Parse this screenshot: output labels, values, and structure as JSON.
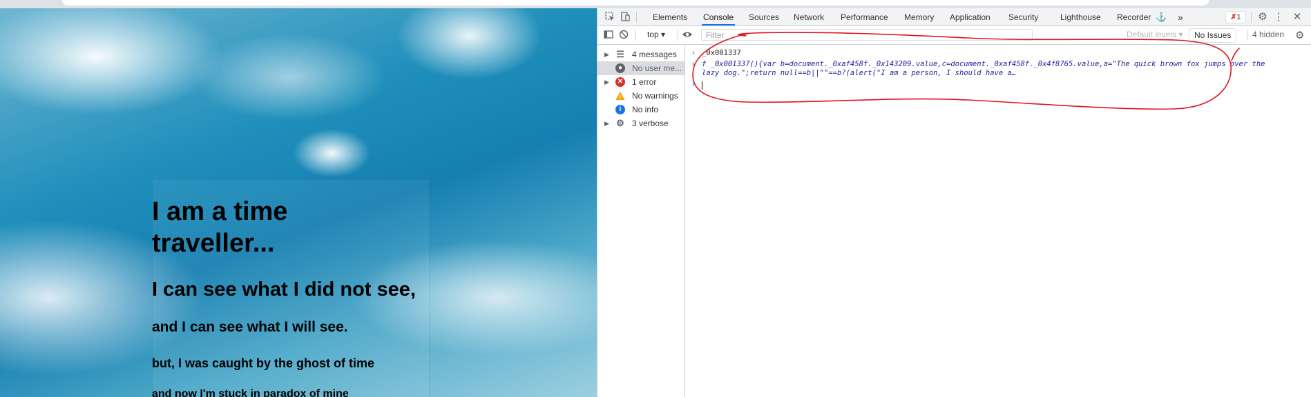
{
  "webpage": {
    "heading1": "I am a time traveller...",
    "line2": "I can see what I did not see,",
    "line3": "and I can see what I will see.",
    "line4": "but, I was caught by the ghost of time",
    "line5": "and now I'm stuck in paradox of mine"
  },
  "devtools": {
    "tabs": [
      "Elements",
      "Console",
      "Sources",
      "Network",
      "Performance",
      "Memory",
      "Application",
      "Security",
      "Lighthouse",
      "Recorder"
    ],
    "active_tab": "Console",
    "more_tabs": "»",
    "error_badge": "1",
    "toolbar": {
      "context": "top",
      "filter_placeholder": "Filter",
      "levels": "Default levels",
      "issues": "No Issues",
      "hidden": "4 hidden"
    },
    "sidebar": [
      {
        "label": "4 messages",
        "icon": "list-icon"
      },
      {
        "label": "No user me...",
        "icon": "user-icon"
      },
      {
        "label": "1 error",
        "icon": "error-icon"
      },
      {
        "label": "No warnings",
        "icon": "warning-icon"
      },
      {
        "label": "No info",
        "icon": "info-icon"
      },
      {
        "label": "3 verbose",
        "icon": "bug-icon"
      }
    ],
    "console": {
      "input": "_0x001337",
      "output_line1": "f _0x001337(){var b=document._0xaf458f._0x143209.value,c=document._0xaf458f._0x4f8765.value,a=\"The quick brown fox jumps over the",
      "output_line2": "lazy dog.\";return null==b||\"\"==b?(alert(\"I am a person, I should have a…"
    }
  },
  "colors": {
    "annotation": "#e0141e",
    "accent": "#1a73e8",
    "error": "#d93025"
  }
}
